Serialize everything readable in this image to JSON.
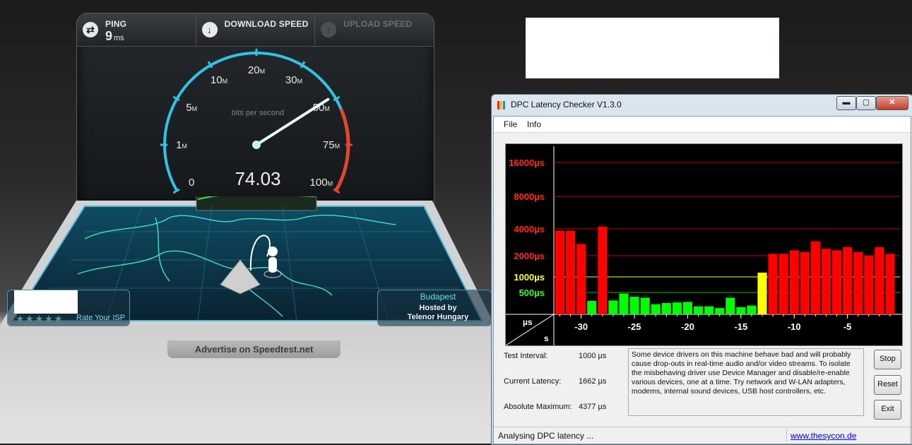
{
  "speedtest": {
    "tabs": [
      {
        "label": "PING",
        "value": "9",
        "unit": "ms"
      },
      {
        "label": "DOWNLOAD SPEED"
      },
      {
        "label": "UPLOAD SPEED"
      }
    ],
    "gauge": {
      "caption": "bits per second",
      "value": "74.03",
      "fraction": 0.74,
      "ticks": [
        {
          "num": "0",
          "unit": ""
        },
        {
          "num": "1",
          "unit": "M"
        },
        {
          "num": "5",
          "unit": "M"
        },
        {
          "num": "10",
          "unit": "M"
        },
        {
          "num": "20",
          "unit": "M"
        },
        {
          "num": "30",
          "unit": "M"
        },
        {
          "num": "50",
          "unit": "M"
        },
        {
          "num": "75",
          "unit": "M"
        },
        {
          "num": "100",
          "unit": "M"
        }
      ]
    },
    "rate": {
      "stars": "★★★★★",
      "label": "Rate Your ISP"
    },
    "server": {
      "city": "Budapest",
      "hosted_by": "Hosted by",
      "host": "Telenor Hungary"
    },
    "advertise": "Advertise on Speedtest.net",
    "colors": {
      "accent": "#2fc3e6",
      "danger": "#e2472b"
    }
  },
  "dpc": {
    "title": "DPC Latency Checker V1.3.0",
    "window_buttons": {
      "minimize": "▬",
      "maximize": "▢",
      "close": "✕"
    },
    "menu": [
      "File",
      "Info"
    ],
    "chart_data": {
      "type": "bar",
      "y_labels": [
        "16000µs",
        "8000µs",
        "4000µs",
        "2000µs",
        "1000µs",
        "500µs"
      ],
      "x_ticks": [
        "-30",
        "-25",
        "-20",
        "-15",
        "-10",
        "-5"
      ],
      "corner_top": "µs",
      "corner_bottom": "s",
      "x": [
        -32,
        -31,
        -30,
        -29,
        -28,
        -27,
        -26,
        -25,
        -24,
        -23,
        -22,
        -21,
        -20,
        -19,
        -18,
        -17,
        -16,
        -15,
        -14,
        -13,
        -12,
        -11,
        -10,
        -9,
        -8,
        -7,
        -6,
        -5,
        -4,
        -3,
        -2,
        -1
      ],
      "values_us": [
        3800,
        3800,
        2700,
        220,
        4200,
        230,
        450,
        330,
        300,
        160,
        180,
        190,
        200,
        130,
        130,
        110,
        300,
        120,
        140,
        1150,
        2100,
        2100,
        2300,
        2200,
        2900,
        2400,
        2300,
        2500,
        2200,
        2000,
        2500,
        2100
      ],
      "colors": {
        "ok": "#00ff00",
        "warn": "#ffff00",
        "bad": "#ff0000",
        "grid_red": "#c00000",
        "grid_yellow": "#ffff00",
        "grid_green": "#00c000"
      }
    },
    "stats": [
      {
        "label": "Test Interval:",
        "value": "1000 µs"
      },
      {
        "label": "Current Latency:",
        "value": "1662 µs"
      },
      {
        "label": "Absolute Maximum:",
        "value": "4377 µs"
      }
    ],
    "info_text": "Some device drivers on this machine behave bad and will probably cause drop-outs in real-time audio and/or video streams. To isolate the misbehaving driver use Device Manager and disable/re-enable various devices, one at a time. Try network and W-LAN adapters, modems, internal sound devices, USB host controllers, etc.",
    "buttons": {
      "stop": "Stop",
      "reset": "Reset",
      "exit": "Exit"
    },
    "status": "Analysing DPC latency ...",
    "link": "www.thesycon.de"
  }
}
